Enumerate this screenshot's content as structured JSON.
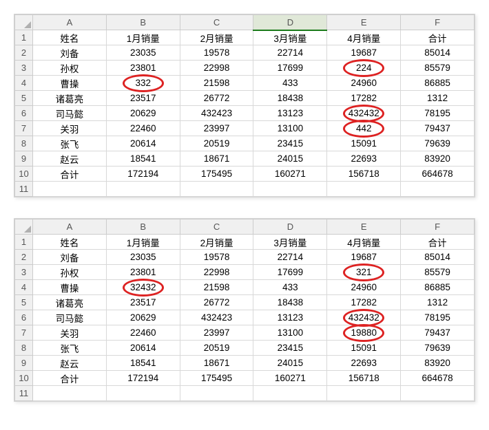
{
  "columns": [
    "A",
    "B",
    "C",
    "D",
    "E",
    "F"
  ],
  "headers": [
    "姓名",
    "1月销量",
    "2月销量",
    "3月销量",
    "4月销量",
    "合计"
  ],
  "table1": {
    "selected_col": 3,
    "rows": [
      [
        "刘备",
        "23035",
        "19578",
        "22714",
        "19687",
        "85014"
      ],
      [
        "孙权",
        "23801",
        "22998",
        "17699",
        "224",
        "85579"
      ],
      [
        "曹操",
        "332",
        "21598",
        "433",
        "24960",
        "86885"
      ],
      [
        "诸葛亮",
        "23517",
        "26772",
        "18438",
        "17282",
        "1312"
      ],
      [
        "司马懿",
        "20629",
        "432423",
        "13123",
        "432432",
        "78195"
      ],
      [
        "关羽",
        "22460",
        "23997",
        "13100",
        "442",
        "79437"
      ],
      [
        "张飞",
        "20614",
        "20519",
        "23415",
        "15091",
        "79639"
      ],
      [
        "赵云",
        "18541",
        "18671",
        "24015",
        "22693",
        "83920"
      ],
      [
        "合计",
        "172194",
        "175495",
        "160271",
        "156718",
        "664678"
      ],
      [
        "",
        "",
        "",
        "",
        "",
        ""
      ]
    ],
    "circles": [
      {
        "row": 1,
        "col": 4
      },
      {
        "row": 2,
        "col": 1
      },
      {
        "row": 4,
        "col": 4
      },
      {
        "row": 5,
        "col": 4
      }
    ]
  },
  "table2": {
    "selected_col": null,
    "rows": [
      [
        "刘备",
        "23035",
        "19578",
        "22714",
        "19687",
        "85014"
      ],
      [
        "孙权",
        "23801",
        "22998",
        "17699",
        "321",
        "85579"
      ],
      [
        "曹操",
        "32432",
        "21598",
        "433",
        "24960",
        "86885"
      ],
      [
        "诸葛亮",
        "23517",
        "26772",
        "18438",
        "17282",
        "1312"
      ],
      [
        "司马懿",
        "20629",
        "432423",
        "13123",
        "432432",
        "78195"
      ],
      [
        "关羽",
        "22460",
        "23997",
        "13100",
        "19880",
        "79437"
      ],
      [
        "张飞",
        "20614",
        "20519",
        "23415",
        "15091",
        "79639"
      ],
      [
        "赵云",
        "18541",
        "18671",
        "24015",
        "22693",
        "83920"
      ],
      [
        "合计",
        "172194",
        "175495",
        "160271",
        "156718",
        "664678"
      ],
      [
        "",
        "",
        "",
        "",
        "",
        ""
      ]
    ],
    "circles": [
      {
        "row": 1,
        "col": 4
      },
      {
        "row": 2,
        "col": 1
      },
      {
        "row": 4,
        "col": 4
      },
      {
        "row": 5,
        "col": 4
      }
    ]
  }
}
